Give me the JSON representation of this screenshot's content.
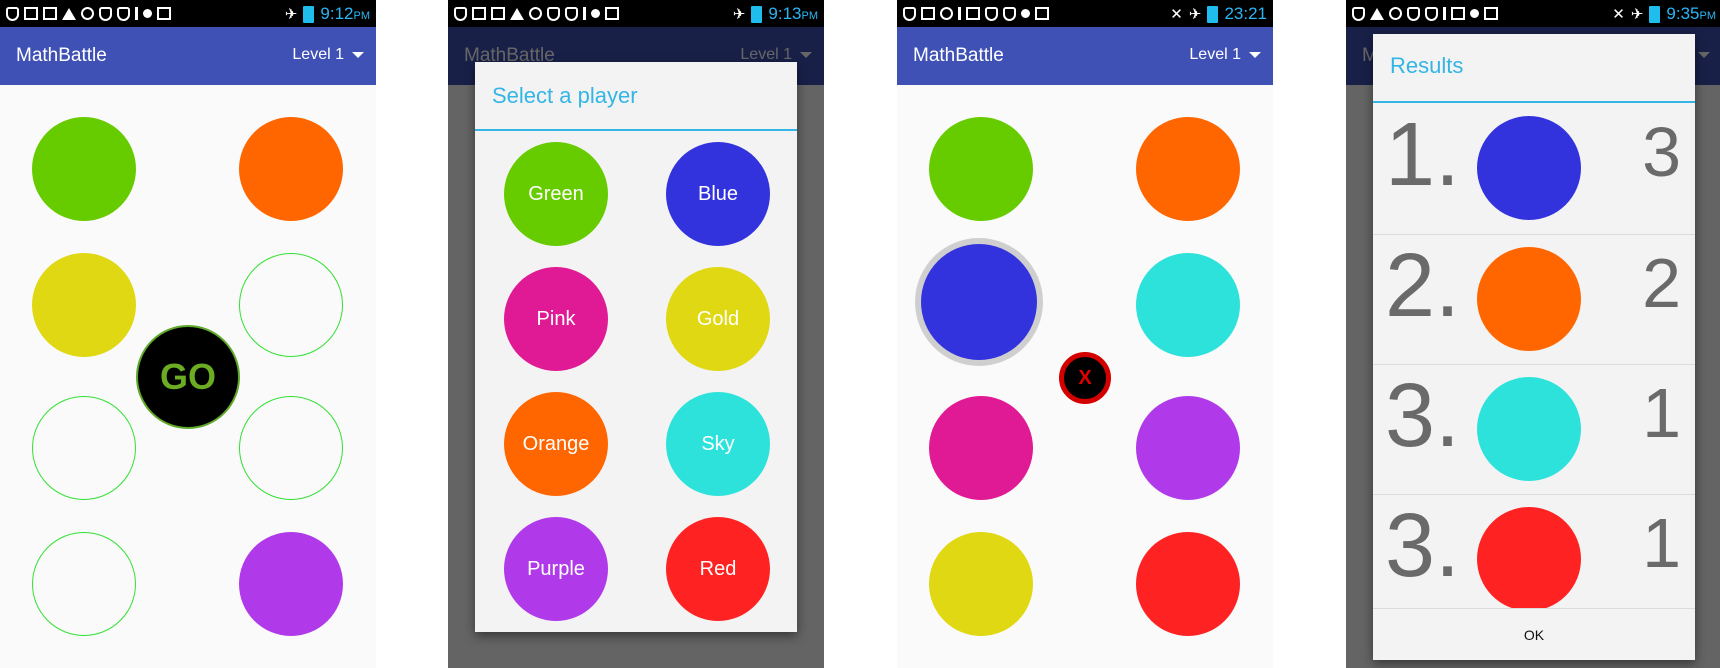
{
  "colors": {
    "green": "#66cc00",
    "orange": "#ff6600",
    "gold": "#dfd812",
    "purple": "#b03ae9",
    "blue": "#3333dd",
    "sky": "#2ee2dc",
    "pink": "#e01994",
    "red": "#ff2222",
    "appbar": "#3f51b5",
    "dialog_accent": "#33b5e5"
  },
  "app": {
    "title": "MathBattle",
    "level": "Level 1"
  },
  "screens": [
    {
      "time": "9:12",
      "ampm": "PM",
      "icons": [
        "shield-icon",
        "exit-icon",
        "image-icon",
        "warning-icon",
        "whatsapp-icon",
        "shield-icon",
        "shield-icon",
        "usb-icon",
        "android-icon",
        "vibrate-icon",
        "airplane-icon",
        "battery-icon"
      ],
      "go_label": "GO"
    },
    {
      "time": "9:13",
      "ampm": "PM",
      "dialog": {
        "title": "Select a player",
        "players": [
          "Green",
          "Blue",
          "Pink",
          "Gold",
          "Orange",
          "Sky",
          "Purple",
          "Red"
        ]
      }
    },
    {
      "time": "23:21",
      "ampm": "",
      "x_label": "X"
    },
    {
      "time": "9:35",
      "ampm": "PM",
      "dialog": {
        "title": "Results",
        "rows": [
          {
            "rank": "1.",
            "color": "blue",
            "score": "3"
          },
          {
            "rank": "2.",
            "color": "orange",
            "score": "2"
          },
          {
            "rank": "3.",
            "color": "sky",
            "score": "1"
          },
          {
            "rank": "3.",
            "color": "red",
            "score": "1"
          }
        ],
        "ok": "OK"
      }
    }
  ]
}
